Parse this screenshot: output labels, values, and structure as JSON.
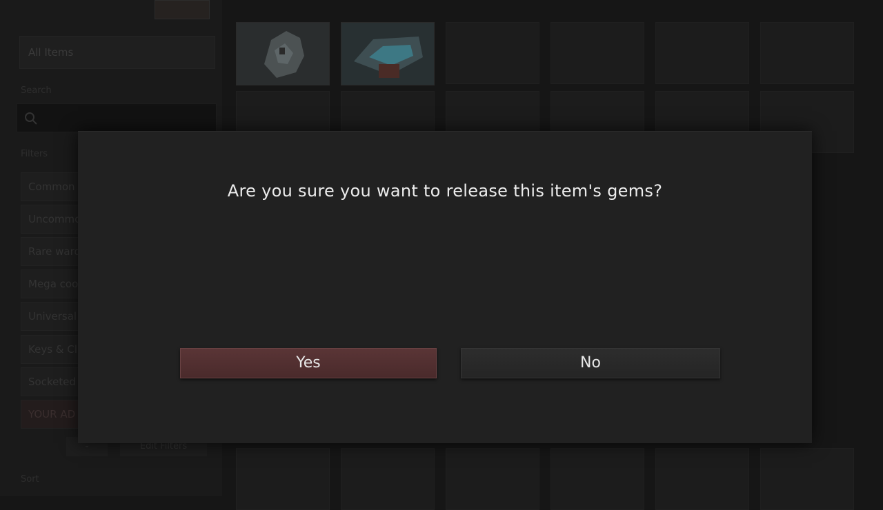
{
  "background": {
    "all_items_label": "All Items",
    "search_label": "Search",
    "filters_label": "Filters",
    "filters": [
      "Common",
      "Uncommo",
      "Rare ward",
      "Mega coo",
      "Universal",
      "Keys & Cl",
      "Socketed",
      "YOUR AD"
    ],
    "minus_label": "-",
    "edit_filters_label": "Edit Filters",
    "sort_label": "Sort"
  },
  "dialog": {
    "message": "Are you sure you want to release this item's gems?",
    "yes_label": "Yes",
    "no_label": "No"
  },
  "colors": {
    "yes_button": "#5a3536",
    "no_button": "#2d2d2d",
    "dialog_bg": "#212121"
  }
}
